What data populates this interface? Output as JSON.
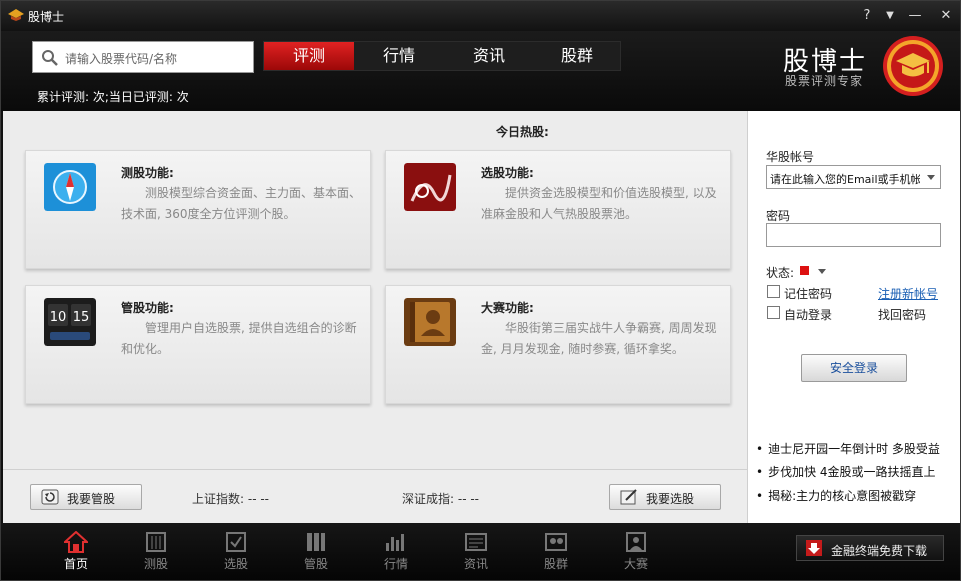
{
  "window": {
    "title": "股博士",
    "controls": {
      "help": "?",
      "menu": "▼",
      "minimize": "—",
      "close": "✕"
    }
  },
  "header": {
    "search_placeholder": "请输入股票代码/名称",
    "tabs": [
      "评测",
      "行情",
      "资讯",
      "股群"
    ],
    "active_tab": "评测",
    "stats_text": "累计评测:    次;当日已评测:    次",
    "brand_name": "股博士",
    "brand_subtitle": "股票评测专家"
  },
  "main": {
    "hot_label": "今日热股:",
    "cards": [
      {
        "title": "测股功能:",
        "desc": "测股模型综合资金面、主力面、基本面、技术面, 360度全方位评测个股。",
        "icon": "compass-icon"
      },
      {
        "title": "选股功能:",
        "desc": "提供资金选股模型和价值选股模型, 以及准麻金股和人气热股股票池。",
        "icon": "stock-pick-icon"
      },
      {
        "title": "管股功能:",
        "desc": "管理用户自选股票, 提供自选组合的诊断和优化。",
        "icon": "clock-icon"
      },
      {
        "title": "大赛功能:",
        "desc": "华股街第三届实战牛人争霸赛, 周周发现金, 月月发现金, 随时参赛, 循环拿奖。",
        "icon": "contacts-book-icon"
      }
    ],
    "bottom": {
      "manage_btn": "我要管股",
      "sh_index": "上证指数:  --  --",
      "sz_index": "深证成指:  --  --",
      "select_btn": "我要选股"
    }
  },
  "login": {
    "account_label": "华股帐号",
    "account_value": "请在此输入您的Email或手机帐号",
    "password_label": "密码",
    "status_label": "状态:",
    "remember_label": "记住密码",
    "autologin_label": "自动登录",
    "register_link": "注册新帐号",
    "recover_link": "找回密码",
    "login_button": "安全登录",
    "news": [
      "迪士尼开园一年倒计时 多股受益",
      "步伐加快 4金股或一路扶摇直上",
      "揭秘:主力的核心意图被戳穿"
    ]
  },
  "nav": {
    "items": [
      {
        "label": "首页",
        "icon": "home-icon"
      },
      {
        "label": "测股",
        "icon": "building-icon"
      },
      {
        "label": "选股",
        "icon": "checkbox-icon"
      },
      {
        "label": "管股",
        "icon": "books-icon"
      },
      {
        "label": "行情",
        "icon": "bar-chart-icon"
      },
      {
        "label": "资讯",
        "icon": "news-icon"
      },
      {
        "label": "股群",
        "icon": "group-icon"
      },
      {
        "label": "大赛",
        "icon": "contest-icon"
      }
    ],
    "active": "首页",
    "download_label": "金融终端免费下载"
  },
  "colors": {
    "accent_red": "#d42020",
    "link_blue": "#1a5fb4"
  }
}
